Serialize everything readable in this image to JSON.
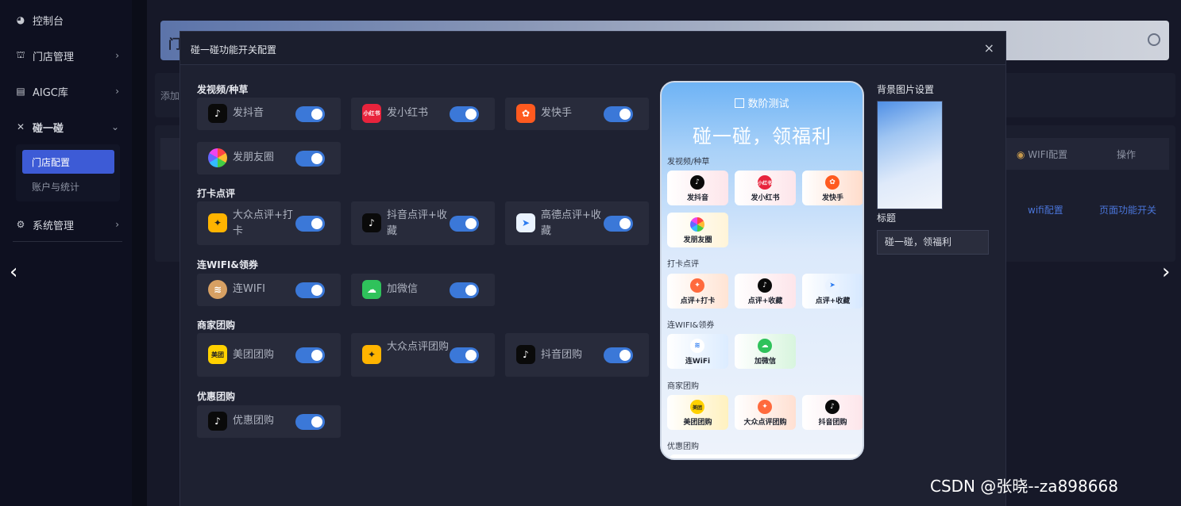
{
  "sidebar": {
    "items": [
      {
        "label": "控制台",
        "icon": "dashboard-icon"
      },
      {
        "label": "门店管理",
        "icon": "store-icon"
      },
      {
        "label": "AIGC库",
        "icon": "printer-icon"
      },
      {
        "label": "碰一碰",
        "icon": "tap-icon"
      },
      {
        "label": "系统管理",
        "icon": "gear-icon"
      }
    ],
    "sub_items": [
      "门店配置",
      "账户与统计"
    ]
  },
  "background": {
    "header_partial": "门",
    "add_partial": "添加",
    "th_wifi": "WIFI配置",
    "th_ops": "操作",
    "link_wifi": "wifi配置",
    "link_page": "页面功能开关"
  },
  "modal": {
    "title": "碰一碰功能开关配置",
    "close": "×",
    "sections": [
      {
        "title": "发视频/种草",
        "items": [
          {
            "label": "发抖音",
            "icon": "douyin-icon",
            "on": true
          },
          {
            "label": "发小红书",
            "icon": "xiaohongshu-icon",
            "on": true
          },
          {
            "label": "发快手",
            "icon": "kuaishou-icon",
            "on": true
          },
          {
            "label": "发朋友圈",
            "icon": "moments-icon",
            "on": true
          }
        ]
      },
      {
        "title": "打卡点评",
        "items": [
          {
            "label": "大众点评+打卡",
            "icon": "dianping-icon",
            "on": true
          },
          {
            "label": "抖音点评+收藏",
            "icon": "douyin-icon",
            "on": true
          },
          {
            "label": "高德点评+收藏",
            "icon": "amap-icon",
            "on": true
          }
        ]
      },
      {
        "title": "连WIFI&领券",
        "items": [
          {
            "label": "连WIFI",
            "icon": "wifi-icon",
            "on": true
          },
          {
            "label": "加微信",
            "icon": "wechat-icon",
            "on": true
          }
        ]
      },
      {
        "title": "商家团购",
        "items": [
          {
            "label": "美团团购",
            "icon": "meituan-icon",
            "on": true
          },
          {
            "label": "大众点评团购",
            "icon": "dianping-icon",
            "on": true
          },
          {
            "label": "抖音团购",
            "icon": "douyin-icon",
            "on": true
          }
        ]
      },
      {
        "title": "优惠团购",
        "items": [
          {
            "label": "优惠团购",
            "icon": "douyin-icon",
            "on": true
          }
        ]
      }
    ],
    "preview": {
      "brand": "数阶测试",
      "headline": "碰一碰，领福利",
      "sections": [
        {
          "title": "发视频/种草",
          "items": [
            "发抖音",
            "发小红书",
            "发快手",
            "发朋友圈"
          ]
        },
        {
          "title": "打卡点评",
          "items": [
            "点评+打卡",
            "点评+收藏",
            "点评+收藏"
          ]
        },
        {
          "title": "连WIFI&领券",
          "items": [
            "连WiFi",
            "加微信"
          ]
        },
        {
          "title": "商家团购",
          "items": [
            "美团团购",
            "大众点评团购",
            "抖音团购"
          ]
        },
        {
          "title": "优惠团购",
          "items": []
        }
      ]
    },
    "settings": {
      "bg_label": "背景图片设置",
      "title_label": "标题",
      "title_value": "碰一碰，领福利"
    }
  },
  "colors": {
    "accent": "#3b78d8",
    "active_nav": "#3d5bd6"
  },
  "watermark": "CSDN @张晓--za898668"
}
